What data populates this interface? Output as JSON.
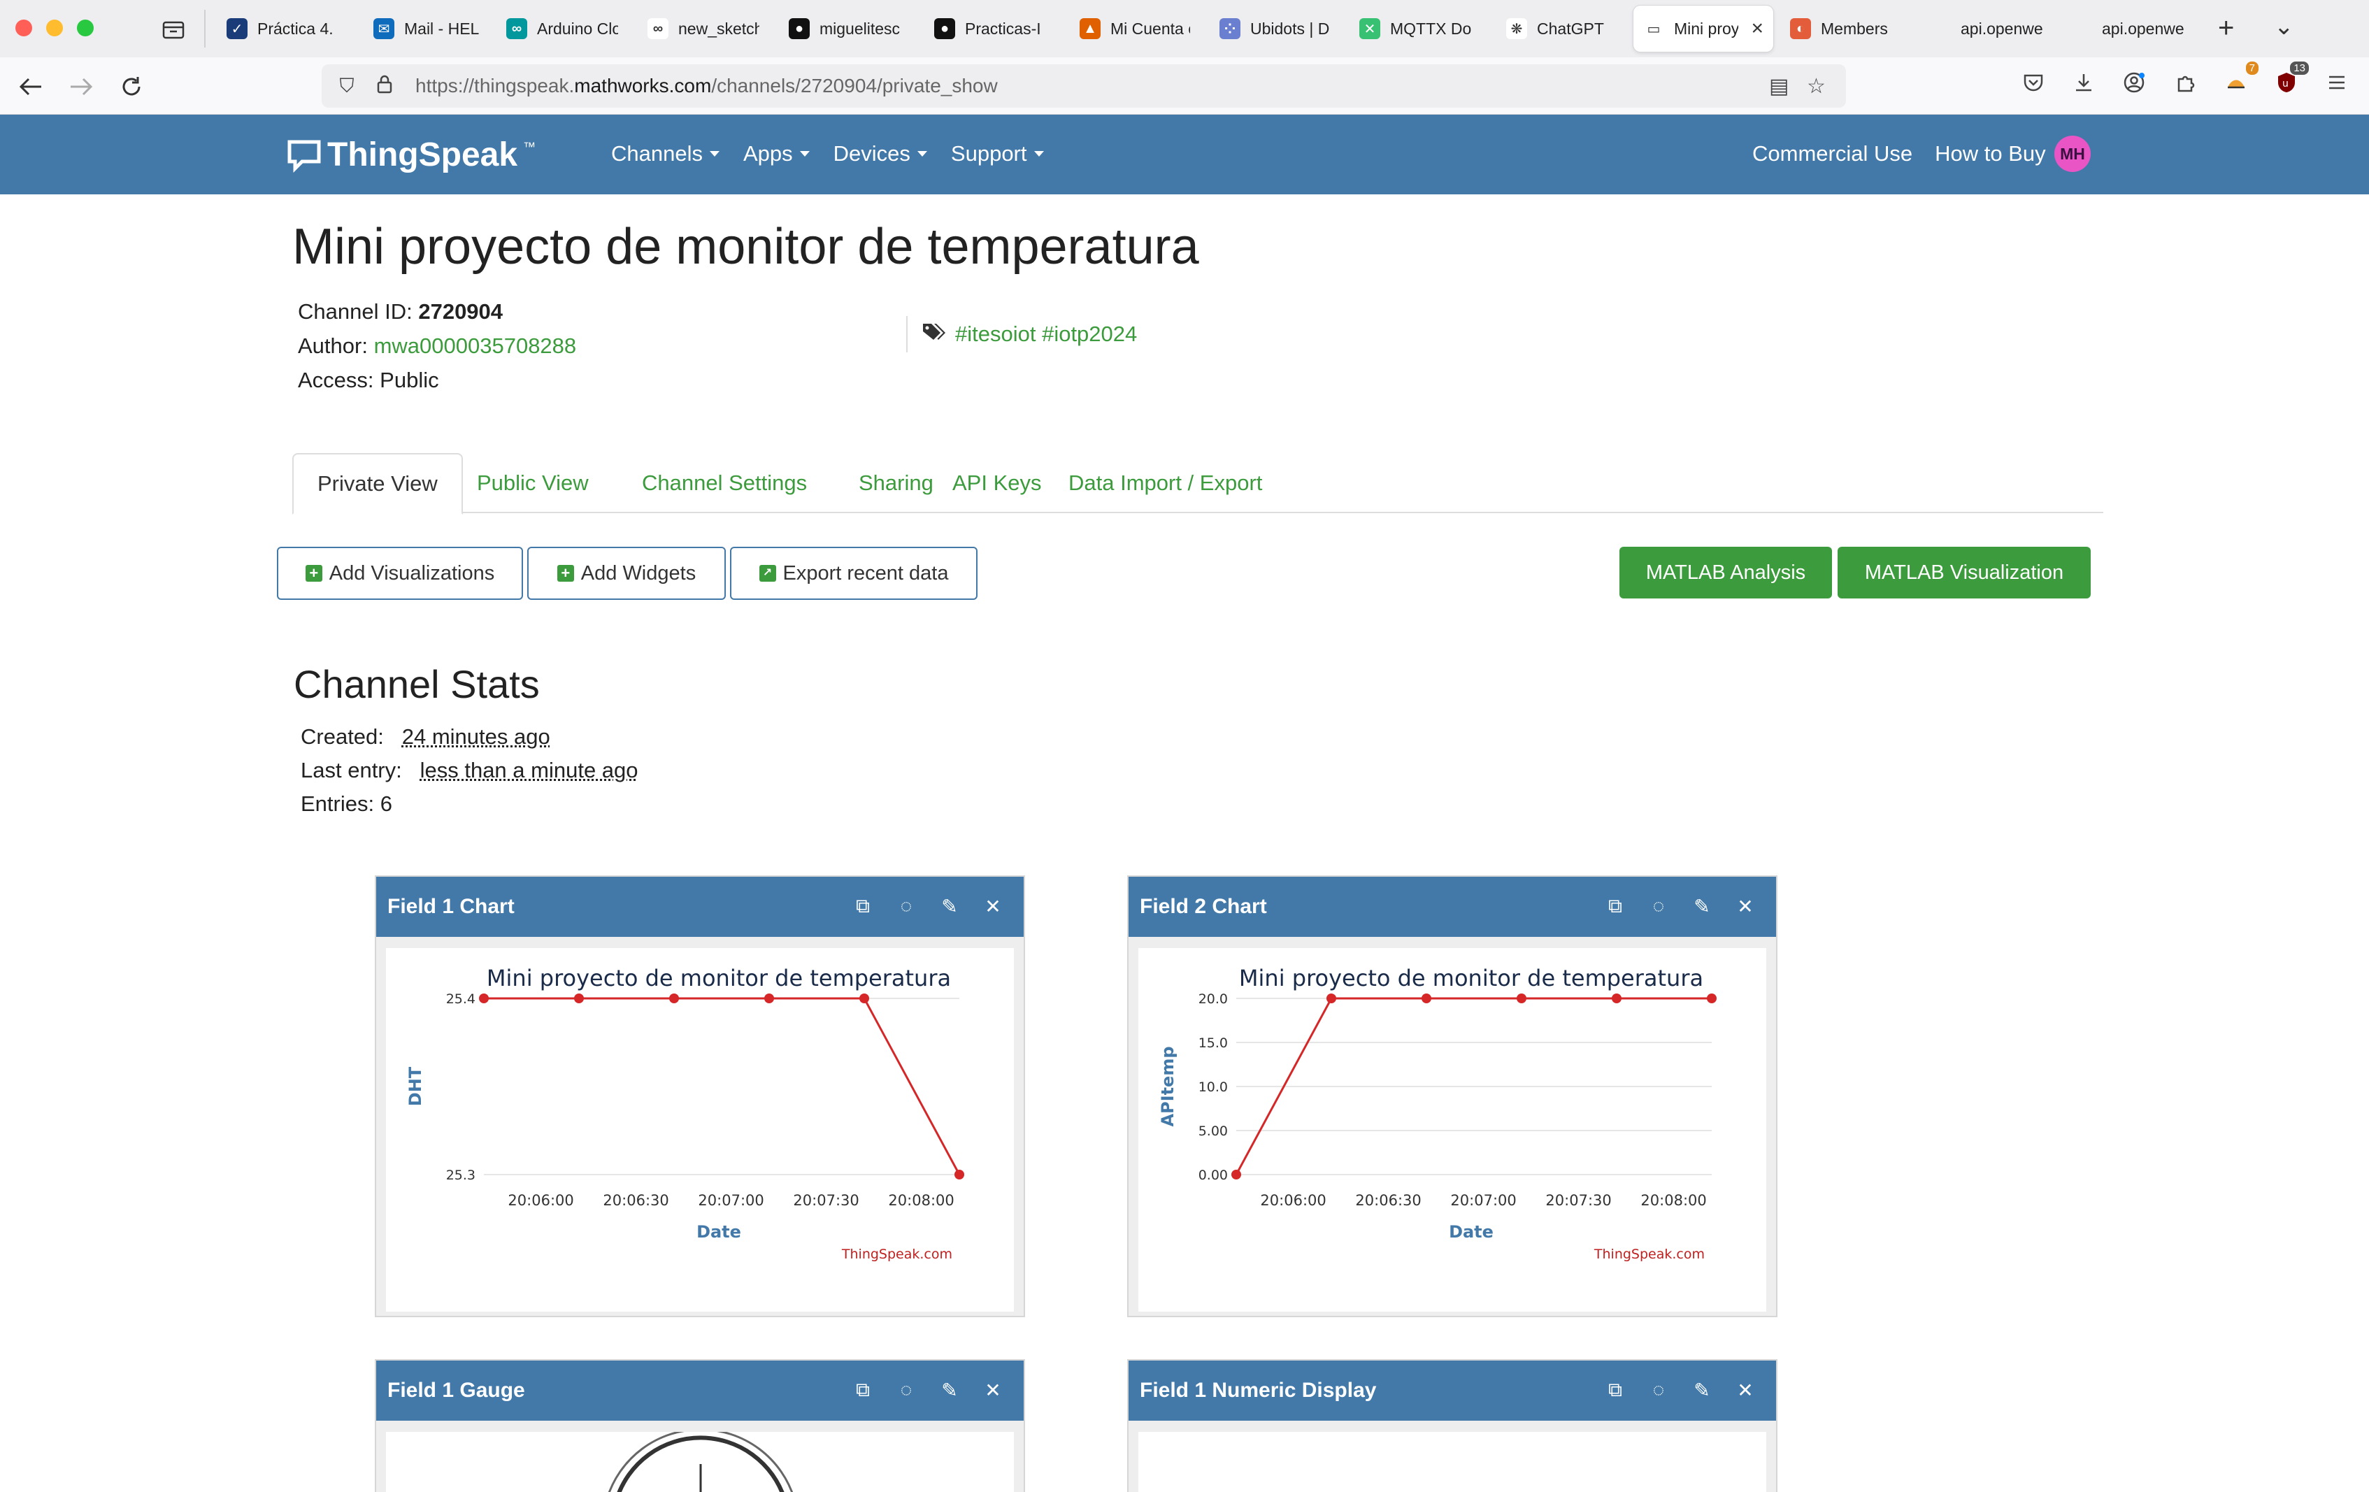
{
  "browser": {
    "tabs": [
      {
        "label": "Práctica 4.",
        "color": "#1a3d7a",
        "glyph": "✓"
      },
      {
        "label": "Mail - HELU",
        "color": "#0f6cbd",
        "glyph": "✉"
      },
      {
        "label": "Arduino Clo",
        "color": "#00979d",
        "glyph": "∞"
      },
      {
        "label": "new_sketch",
        "color": "#ffffff",
        "glyph": "∞"
      },
      {
        "label": "miguelitesc",
        "color": "#111111",
        "glyph": "●"
      },
      {
        "label": "Practicas-I",
        "color": "#111111",
        "glyph": "●"
      },
      {
        "label": "Mi Cuenta c",
        "color": "#e06000",
        "glyph": "▲"
      },
      {
        "label": "Ubidots | D",
        "color": "#6a7fd0",
        "glyph": "⁘"
      },
      {
        "label": "MQTTX Do",
        "color": "#38c172",
        "glyph": "✕"
      },
      {
        "label": "ChatGPT",
        "color": "#ffffff",
        "glyph": "❋"
      },
      {
        "label": "Mini proy",
        "color": "#ffffff",
        "glyph": "▭"
      },
      {
        "label": "Members",
        "color": "#e35d3b",
        "glyph": "◐"
      },
      {
        "label": "api.openweathe",
        "color": "#eeeef0",
        "glyph": ""
      },
      {
        "label": "api.openweathe",
        "color": "#eeeef0",
        "glyph": ""
      }
    ],
    "url_prefix": "https://thingspeak.",
    "url_domain": "mathworks.com",
    "url_path": "/channels/2720904/private_show",
    "badge_downloads": "7",
    "badge_ublock": "13"
  },
  "header": {
    "logo": "ThingSpeak",
    "logo_tm": "™",
    "menu": [
      "Channels",
      "Apps",
      "Devices",
      "Support"
    ],
    "right_links": [
      "Commercial Use",
      "How to Buy"
    ],
    "avatar_initials": "MH"
  },
  "channel": {
    "title": "Mini proyecto de monitor de temperatura",
    "id_label": "Channel ID:",
    "id_value": "2720904",
    "author_label": "Author:",
    "author_value": "mwa0000035708288",
    "access_label": "Access:",
    "access_value": "Public",
    "tags": "#itesoiot #iotp2024"
  },
  "tabs": [
    "Private View",
    "Public View",
    "Channel Settings",
    "Sharing",
    "API Keys",
    "Data Import / Export"
  ],
  "actions": {
    "add_visualizations": "Add Visualizations",
    "add_widgets": "Add Widgets",
    "export_recent": "Export recent data",
    "matlab_analysis": "MATLAB Analysis",
    "matlab_visualization": "MATLAB Visualization"
  },
  "stats": {
    "title": "Channel Stats",
    "created_label": "Created:",
    "created_value": "24 minutes ago",
    "last_entry_label": "Last entry:",
    "last_entry_value": "less than a minute ago",
    "entries_label": "Entries:",
    "entries_value": "6"
  },
  "widgets": [
    {
      "title": "Field 1 Chart"
    },
    {
      "title": "Field 2 Chart"
    },
    {
      "title": "Field 1 Gauge"
    },
    {
      "title": "Field 1 Numeric Display"
    }
  ],
  "chart_data": [
    {
      "type": "line",
      "title": "Mini proyecto de monitor de temperatura",
      "xlabel": "Date",
      "ylabel": "DHT",
      "credit": "ThingSpeak.com",
      "x_ticks": [
        "20:06:00",
        "20:06:30",
        "20:07:00",
        "20:07:30",
        "20:08:00"
      ],
      "y_ticks": [
        "25.4",
        "25.3"
      ],
      "ylim": [
        25.3,
        25.4
      ],
      "color": "#d62728",
      "series": [
        {
          "values": [
            25.4,
            25.4,
            25.4,
            25.4,
            25.4,
            25.3
          ]
        }
      ]
    },
    {
      "type": "line",
      "title": "Mini proyecto de monitor de temperatura",
      "xlabel": "Date",
      "ylabel": "APItemp",
      "credit": "ThingSpeak.com",
      "x_ticks": [
        "20:06:00",
        "20:06:30",
        "20:07:00",
        "20:07:30",
        "20:08:00"
      ],
      "y_ticks": [
        "20.0",
        "15.0",
        "10.0",
        "5.00",
        "0.00"
      ],
      "ylim": [
        0,
        20
      ],
      "color": "#d62728",
      "series": [
        {
          "values": [
            0,
            20,
            20,
            20,
            20,
            20
          ]
        }
      ]
    }
  ]
}
